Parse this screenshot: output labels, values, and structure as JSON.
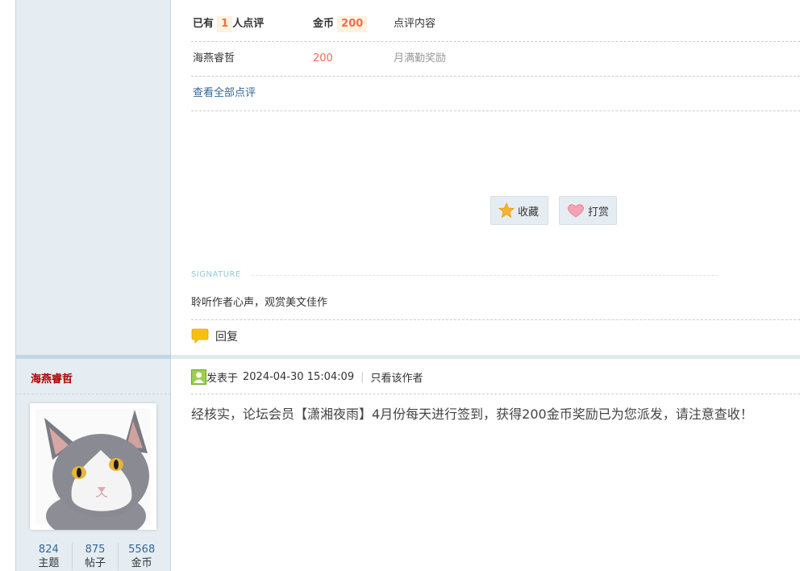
{
  "rate": {
    "header": {
      "prefix": "已有",
      "count": "1",
      "suffix": "人点评",
      "coin_label": "金币",
      "coin_value": "200",
      "content_label": "点评内容"
    },
    "entries": [
      {
        "user": "海燕睿哲",
        "coins": "200",
        "reason": "月满勤奖励"
      }
    ],
    "view_all": "查看全部点评"
  },
  "actions": {
    "favorite_label": "收藏",
    "reward_label": "打赏"
  },
  "signature": {
    "label": "SIGNATURE",
    "text": "聆听作者心声，观赏美文佳作"
  },
  "reply_label": "回复",
  "post2": {
    "author": "海燕睿哲",
    "posted_prefix": "发表于",
    "posted_time": "2024-04-30 15:04:09",
    "only_author": "只看该作者",
    "content": "经核实，论坛会员【潇湘夜雨】4月份每天进行签到，获得200金币奖励已为您派发，请注意查收！",
    "stats": [
      {
        "value": "824",
        "label": "主题"
      },
      {
        "value": "875",
        "label": "帖子"
      },
      {
        "value": "5568",
        "label": "金币"
      }
    ]
  },
  "colors": {
    "sidebar_bg": "#e5edf2",
    "accent_orange": "#f26c4f",
    "link_blue": "#336699",
    "author_red": "#aa0000"
  },
  "icons": {
    "favorite": "star-icon",
    "reward": "heart-icon",
    "reply": "speech-bubble-icon",
    "author": "user-icon"
  }
}
